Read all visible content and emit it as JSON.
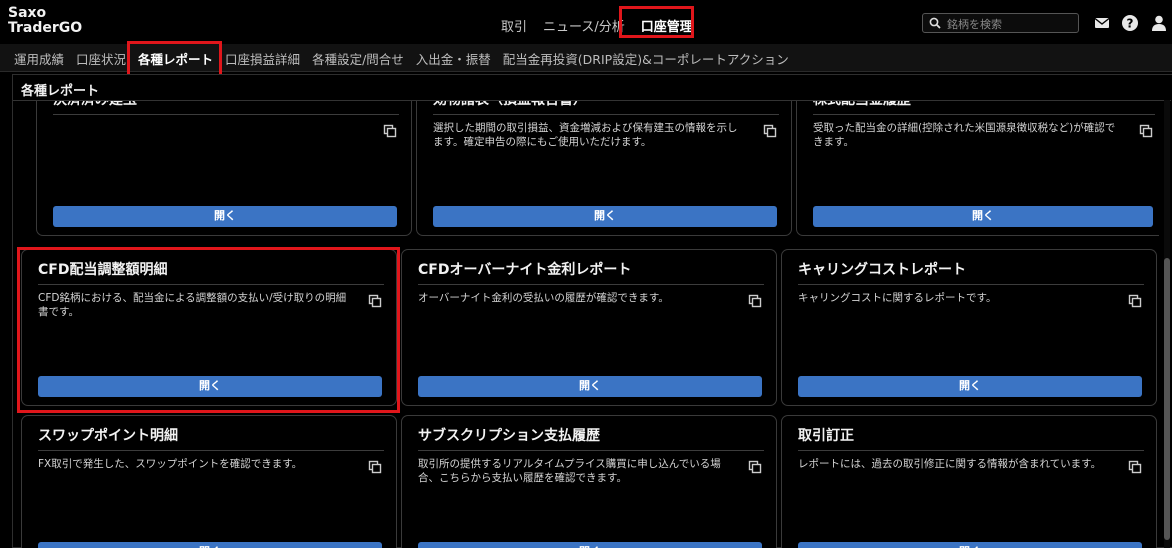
{
  "app": {
    "logo_line1": "Saxo",
    "logo_line2": "TraderGO"
  },
  "topnav": [
    {
      "label": "取引"
    },
    {
      "label": "ニュース/分析"
    },
    {
      "label": "口座管理"
    }
  ],
  "search": {
    "placeholder": "銘柄を検索"
  },
  "icons": {
    "mail": "mail-icon",
    "help": "help-icon",
    "user": "user-icon",
    "copy": "copy-icon",
    "search": "search-icon"
  },
  "colors": {
    "accent": "#3b74c4",
    "highlight": "#e0161b"
  },
  "subnav": [
    {
      "label": "運用成績"
    },
    {
      "label": "口座状況"
    },
    {
      "label": "各種レポート"
    },
    {
      "label": "口座損益詳細"
    },
    {
      "label": "各種設定/問合せ"
    },
    {
      "label": "入出金・振替"
    },
    {
      "label": "配当金再投資(DRIP設定)&コーポレートアクション"
    }
  ],
  "panel": {
    "title": "各種レポート"
  },
  "cards": [
    {
      "title": "決済済み建玉",
      "desc": "",
      "button": "開く"
    },
    {
      "title": "効物諸表（損益報告書）",
      "desc": "選択した期間の取引損益、資金増減および保有建玉の情報を示します。確定申告の際にもご使用いただけます。",
      "button": "開く"
    },
    {
      "title": "株式配当金履歴",
      "desc": "受取った配当金の詳細(控除された米国源泉徴収税など)が確認できます。",
      "button": "開く"
    },
    {
      "title": "CFD配当調整額明細",
      "desc": "CFD銘柄における、配当金による調整額の支払い/受け取りの明細書です。",
      "button": "開く"
    },
    {
      "title": "CFDオーバーナイト金利レポート",
      "desc": "オーバーナイト金利の受払いの履歴が確認できます。",
      "button": "開く"
    },
    {
      "title": "キャリングコストレポート",
      "desc": "キャリングコストに関するレポートです。",
      "button": "開く"
    },
    {
      "title": "スワップポイント明細",
      "desc": "FX取引で発生した、スワップポイントを確認できます。",
      "button": "開く"
    },
    {
      "title": "サブスクリプション支払履歴",
      "desc": "取引所の提供するリアルタイムプライス購買に申し込んでいる場合、こちらから支払い履歴を確認できます。",
      "button": "開く"
    },
    {
      "title": "取引訂正",
      "desc": "レポートには、過去の取引修正に関する情報が含まれています。",
      "button": "開く"
    }
  ]
}
